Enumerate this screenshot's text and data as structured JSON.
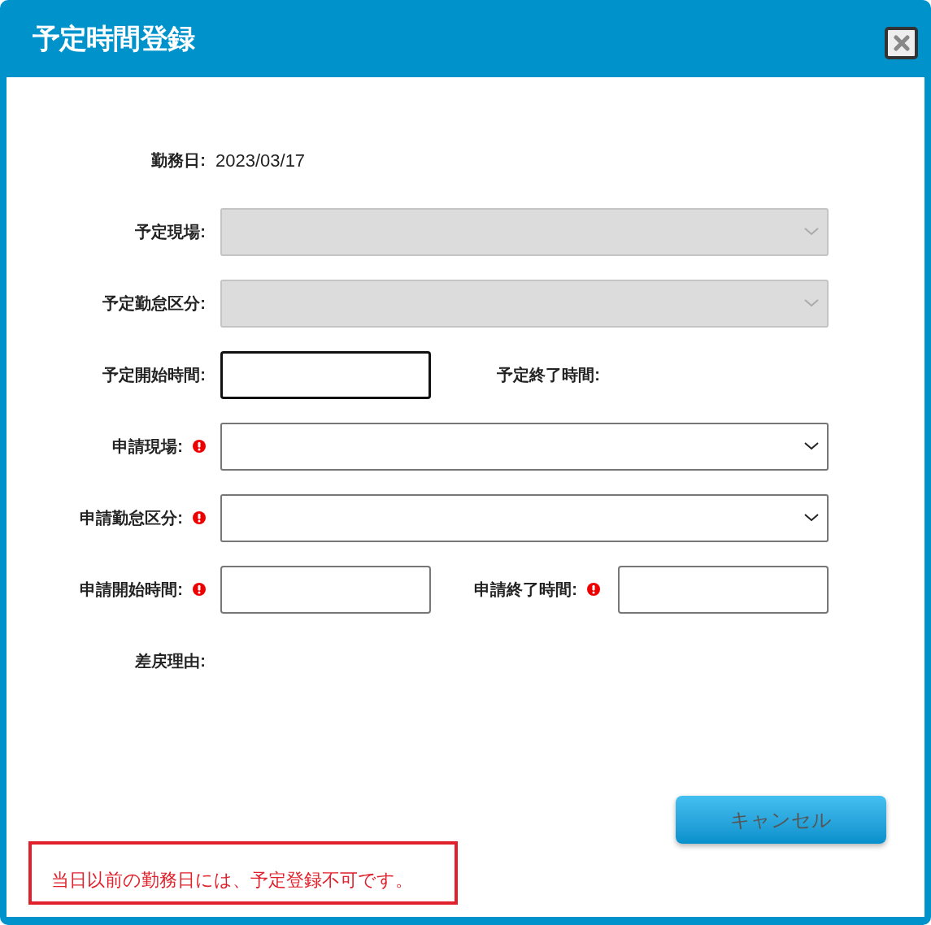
{
  "dialog": {
    "title": "予定時間登録"
  },
  "rows": [
    {
      "fields": [
        {
          "label": "勤務日:",
          "required": false,
          "kind": "text",
          "value": "2023/03/17"
        }
      ]
    },
    {
      "fields": [
        {
          "label": "予定現場:",
          "required": false,
          "kind": "select",
          "disabled": true
        }
      ]
    },
    {
      "fields": [
        {
          "label": "予定勤怠区分:",
          "required": false,
          "kind": "select",
          "disabled": true
        }
      ]
    },
    {
      "fields": [
        {
          "label": "予定開始時間:",
          "required": false,
          "kind": "input",
          "focused": true
        },
        {
          "label": "予定終了時間:",
          "required": false,
          "kind": "none"
        }
      ]
    },
    {
      "fields": [
        {
          "label": "申請現場:",
          "required": true,
          "kind": "select",
          "disabled": false
        }
      ]
    },
    {
      "fields": [
        {
          "label": "申請勤怠区分:",
          "required": true,
          "kind": "select",
          "disabled": false
        }
      ]
    },
    {
      "fields": [
        {
          "label": "申請開始時間:",
          "required": true,
          "kind": "input",
          "focused": false
        },
        {
          "label": "申請終了時間:",
          "required": true,
          "kind": "input",
          "focused": false
        }
      ]
    },
    {
      "fields": [
        {
          "label": "差戻理由:",
          "required": false,
          "kind": "none"
        }
      ]
    }
  ],
  "buttons": [
    {
      "label": "キャンセル"
    }
  ],
  "error_message": "当日以前の勤務日には、予定登録不可です。"
}
